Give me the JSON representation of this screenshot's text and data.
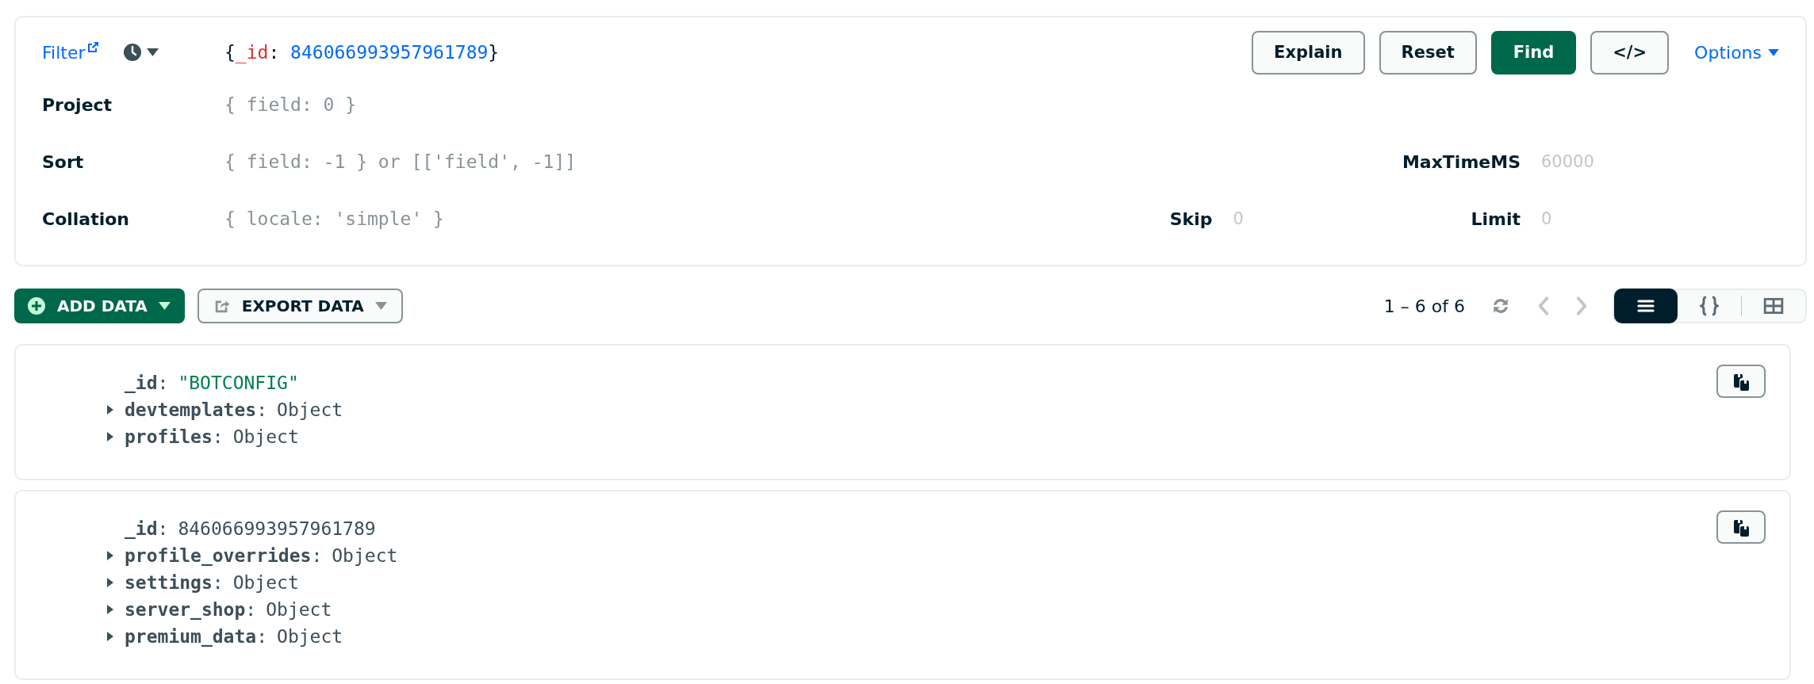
{
  "query_bar": {
    "filter_label": "Filter",
    "filter_value": [
      {
        "kind": "punct",
        "text": "{"
      },
      {
        "kind": "key",
        "text": "_id"
      },
      {
        "kind": "punct",
        "text": ": "
      },
      {
        "kind": "number",
        "text": "846066993957961789"
      },
      {
        "kind": "punct",
        "text": "}"
      }
    ],
    "buttons": [
      {
        "label": "Explain",
        "kind": "secondary"
      },
      {
        "label": "Reset",
        "kind": "secondary"
      },
      {
        "label": "Find",
        "kind": "primary"
      },
      {
        "label": "</>",
        "kind": "secondary"
      }
    ],
    "options_label": "Options",
    "project": {
      "label": "Project",
      "placeholder": "{ field: 0 }"
    },
    "sort": {
      "label": "Sort",
      "placeholder": "{ field: -1 } or [['field', -1]]"
    },
    "max_time_ms": {
      "label": "MaxTimeMS",
      "placeholder": "60000"
    },
    "collation": {
      "label": "Collation",
      "placeholder": "{ locale: 'simple' }"
    },
    "skip": {
      "label": "Skip",
      "placeholder": "0"
    },
    "limit": {
      "label": "Limit",
      "placeholder": "0"
    }
  },
  "toolbar": {
    "add_data": "ADD DATA",
    "export_data": "EXPORT DATA",
    "pagination": "1 – 6 of 6",
    "views": [
      {
        "kind": "list",
        "selected": true
      },
      {
        "kind": "json",
        "selected": false
      },
      {
        "kind": "table",
        "selected": false
      }
    ]
  },
  "documents": [
    {
      "fields": [
        {
          "key": "_id",
          "separator": ":",
          "value": "\"BOTCONFIG\"",
          "kind": "string"
        },
        {
          "key": "devtemplates",
          "separator": ":",
          "value": "Object",
          "kind": "object",
          "expanded": false
        },
        {
          "key": "profiles",
          "separator": ":",
          "value": "Object",
          "kind": "object",
          "expanded": false
        }
      ]
    },
    {
      "fields": [
        {
          "key": "_id",
          "separator": ":",
          "value": "846066993957961789",
          "kind": "number"
        },
        {
          "key": "profile_overrides",
          "separator": ":",
          "value": "Object",
          "kind": "object",
          "expanded": false
        },
        {
          "key": "settings",
          "separator": ":",
          "value": "Object",
          "kind": "object",
          "expanded": false
        },
        {
          "key": "server_shop",
          "separator": ":",
          "value": "Object",
          "kind": "object",
          "expanded": false
        },
        {
          "key": "premium_data",
          "separator": ":",
          "value": "Object",
          "kind": "object",
          "expanded": false
        }
      ]
    }
  ]
}
